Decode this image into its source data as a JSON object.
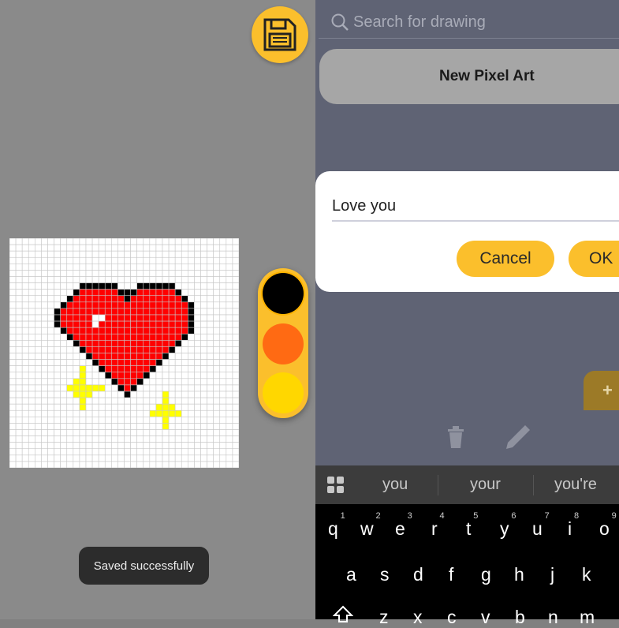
{
  "left_panel": {
    "save_icon": "floppy-disk-icon",
    "palette": {
      "colors": [
        "#000000",
        "#ff6a13",
        "#ffd700"
      ]
    },
    "toast": "Saved successfully"
  },
  "right_panel": {
    "search": {
      "placeholder": "Search for drawing",
      "icon": "search-icon"
    },
    "new_pixel_art": "New Pixel Art",
    "dialog": {
      "input_value": "Love you",
      "cancel": "Cancel",
      "ok": "OK"
    },
    "fab": "+",
    "icons": [
      "trash-icon",
      "pencil-icon"
    ]
  },
  "keyboard": {
    "suggestions": [
      "you",
      "your",
      "you're"
    ],
    "row1": [
      "q",
      "w",
      "e",
      "r",
      "t",
      "y",
      "u",
      "i",
      "o"
    ],
    "row1_hints": [
      "1",
      "2",
      "3",
      "4",
      "5",
      "6",
      "7",
      "8",
      "9"
    ],
    "row2": [
      "a",
      "s",
      "d",
      "f",
      "g",
      "h",
      "j",
      "k"
    ],
    "row3": [
      "z",
      "x",
      "c",
      "v",
      "b",
      "n",
      "m"
    ]
  }
}
